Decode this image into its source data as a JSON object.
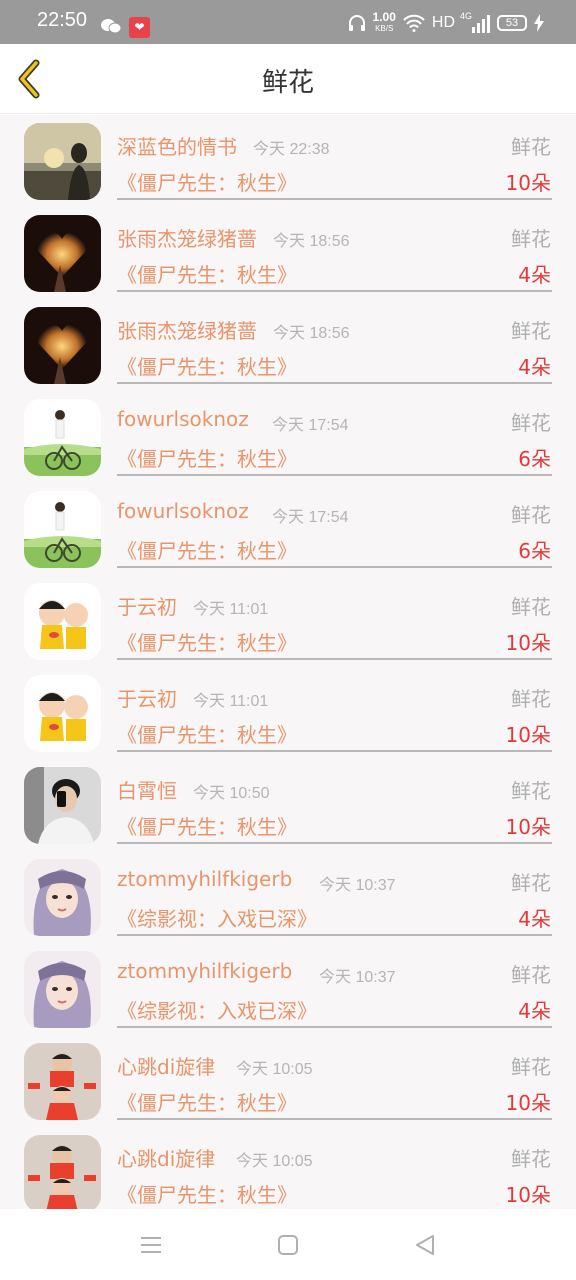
{
  "status_bar": {
    "time": "22:50",
    "network_speed_value": "1.00",
    "network_speed_unit": "KB/S",
    "hd_label": "HD",
    "signal_label": "4G",
    "battery_level": "53",
    "icons": [
      "wechat-icon",
      "app-notification-icon",
      "headphones-icon",
      "wifi-icon",
      "signal-icon",
      "battery-icon",
      "charging-icon"
    ]
  },
  "header": {
    "title": "鲜花",
    "back_icon": "chevron-left-icon",
    "accent": "#f0c419"
  },
  "colors": {
    "name": "#e9956b",
    "time": "#b5b5b5",
    "count": "#e23a3a",
    "gift": "#b0b0b0"
  },
  "items": [
    {
      "name": "深蓝色的情书",
      "time": "今天 22:38",
      "gift": "鲜花",
      "work": "《僵尸先生：秋生》",
      "count": "10朵",
      "avatar": "sunset"
    },
    {
      "name": "张雨杰笼绿猪蔷",
      "time": "今天 18:56",
      "gift": "鲜花",
      "work": "《僵尸先生：秋生》",
      "count": "4朵",
      "avatar": "heart"
    },
    {
      "name": "张雨杰笼绿猪蔷",
      "time": "今天 18:56",
      "gift": "鲜花",
      "work": "《僵尸先生：秋生》",
      "count": "4朵",
      "avatar": "heart"
    },
    {
      "name": "fowurlsoknoz",
      "time": "今天 17:54",
      "gift": "鲜花",
      "work": "《僵尸先生：秋生》",
      "count": "6朵",
      "avatar": "bicycle"
    },
    {
      "name": "fowurlsoknoz",
      "time": "今天 17:54",
      "gift": "鲜花",
      "work": "《僵尸先生：秋生》",
      "count": "6朵",
      "avatar": "bicycle"
    },
    {
      "name": "于云初",
      "time": "今天 11:01",
      "gift": "鲜花",
      "work": "《僵尸先生：秋生》",
      "count": "10朵",
      "avatar": "cartoon"
    },
    {
      "name": "于云初",
      "time": "今天 11:01",
      "gift": "鲜花",
      "work": "《僵尸先生：秋生》",
      "count": "10朵",
      "avatar": "cartoon"
    },
    {
      "name": "白霄恒",
      "time": "今天 10:50",
      "gift": "鲜花",
      "work": "《僵尸先生：秋生》",
      "count": "10朵",
      "avatar": "selfie"
    },
    {
      "name": "ztommyhilfkigerb",
      "time": "今天 10:37",
      "gift": "鲜花",
      "work": "《综影视：入戏已深》",
      "count": "4朵",
      "avatar": "girl"
    },
    {
      "name": "ztommyhilfkigerb",
      "time": "今天 10:37",
      "gift": "鲜花",
      "work": "《综影视：入戏已深》",
      "count": "4朵",
      "avatar": "girl"
    },
    {
      "name": "心跳di旋律",
      "time": "今天 10:05",
      "gift": "鲜花",
      "work": "《僵尸先生：秋生》",
      "count": "10朵",
      "avatar": "kids"
    },
    {
      "name": "心跳di旋律",
      "time": "今天 10:05",
      "gift": "鲜花",
      "work": "《僵尸先生：秋生》",
      "count": "10朵",
      "avatar": "kids"
    }
  ],
  "nav_bar": {
    "icons": [
      "menu-icon",
      "home-icon",
      "back-icon"
    ]
  }
}
